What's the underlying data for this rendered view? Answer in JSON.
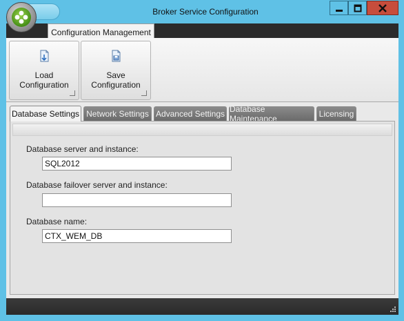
{
  "window": {
    "title": "Broker Service Configuration"
  },
  "title_buttons": {
    "minimize": "minimize-icon",
    "maximize": "maximize-icon",
    "close": "close-icon"
  },
  "ribbon": {
    "tab_label": "Configuration Management",
    "groups": [
      {
        "label": "Load Configuration",
        "icon": "load-config-icon"
      },
      {
        "label": "Save Configuration",
        "icon": "save-config-icon"
      }
    ]
  },
  "tabs": [
    {
      "label": "Database Settings",
      "active": true
    },
    {
      "label": "Network Settings",
      "active": false
    },
    {
      "label": "Advanced Settings",
      "active": false
    },
    {
      "label": "Database Maintenance",
      "active": false
    },
    {
      "label": "Licensing",
      "active": false
    }
  ],
  "database_settings": {
    "server_label": "Database server and instance:",
    "server_value": "SQL2012",
    "failover_label": "Database failover server and instance:",
    "failover_value": "",
    "name_label": "Database name:",
    "name_value": "CTX_WEM_DB"
  },
  "colors": {
    "title_bar": "#5fc1e6",
    "close_button": "#c74d3c",
    "tab_inactive": "#7a7a7a",
    "status_bar": "#2f2f2f"
  }
}
